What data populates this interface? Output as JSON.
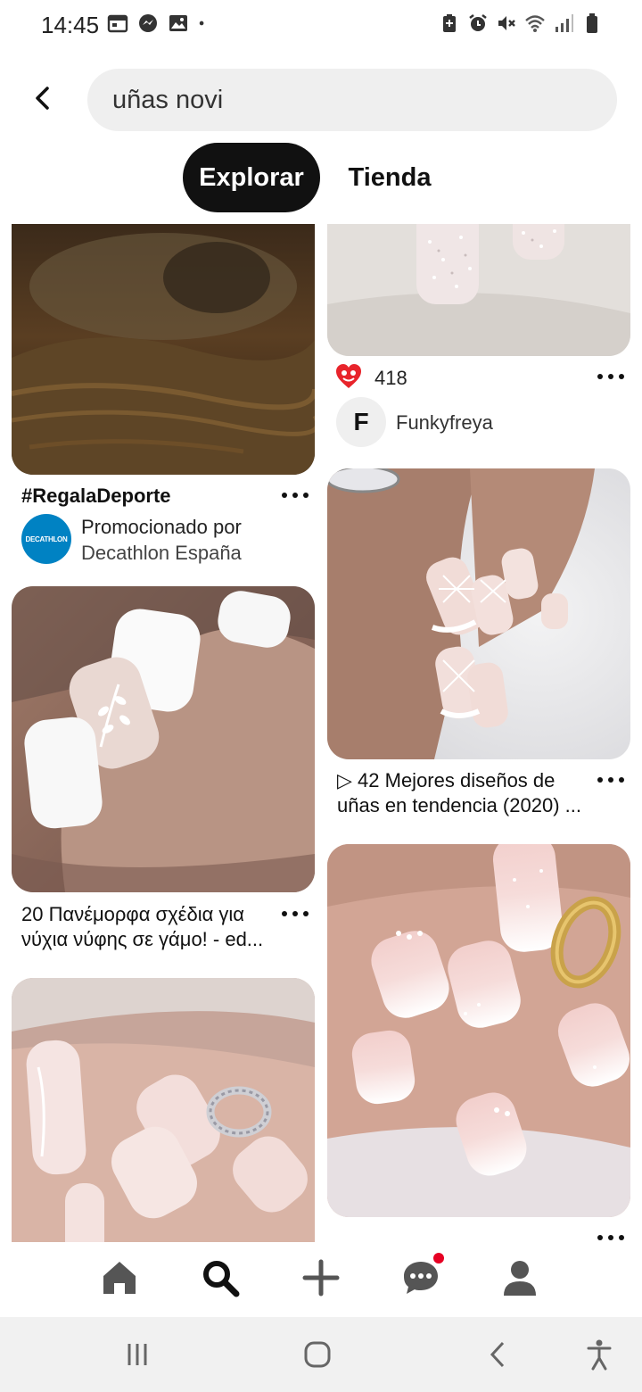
{
  "status_bar": {
    "time": "14:45",
    "left_icons": [
      "calendar-icon",
      "messenger-icon",
      "gallery-icon",
      "dot-icon"
    ],
    "right_icons": [
      "battery-saver-icon",
      "alarm-icon",
      "mute-icon",
      "wifi-icon",
      "signal-icon",
      "battery-icon"
    ]
  },
  "search": {
    "query": "uñas novi",
    "back_icon": "back-arrow-icon"
  },
  "tabs": [
    {
      "label": "Explorar",
      "active": true
    },
    {
      "label": "Tienda",
      "active": false
    }
  ],
  "pins": {
    "promo": {
      "title": "#RegalaDeporte",
      "line1": "Promocionado por",
      "line2": "Decathlon España",
      "logo_text": "DECATHLON",
      "logo_color": "#0082c3"
    },
    "glitter": {
      "reaction_count": "418",
      "reaction_icon": "heart-eyes-icon",
      "avatar_initial": "F",
      "user_name": "Funkyfreya"
    },
    "greek": {
      "title_line1": "20 Πανέμορφα σχέδια για",
      "title_line2": "νύχια νύφης σε γάμο! - ed..."
    },
    "lace": {
      "title_line1": "▷ 42 Mejores diseños de",
      "title_line2": "uñas en tendencia (2020) ..."
    }
  },
  "bottom_nav": [
    {
      "name": "home-icon"
    },
    {
      "name": "search-icon",
      "active": true
    },
    {
      "name": "add-icon"
    },
    {
      "name": "messages-icon",
      "badge": true
    },
    {
      "name": "profile-icon"
    }
  ],
  "system_nav": [
    "recents-icon",
    "home-circle-icon",
    "back-icon",
    "accessibility-icon"
  ],
  "colors": {
    "accent": "#e60023",
    "active_tab_bg": "#111111",
    "search_bg": "#efefef"
  }
}
